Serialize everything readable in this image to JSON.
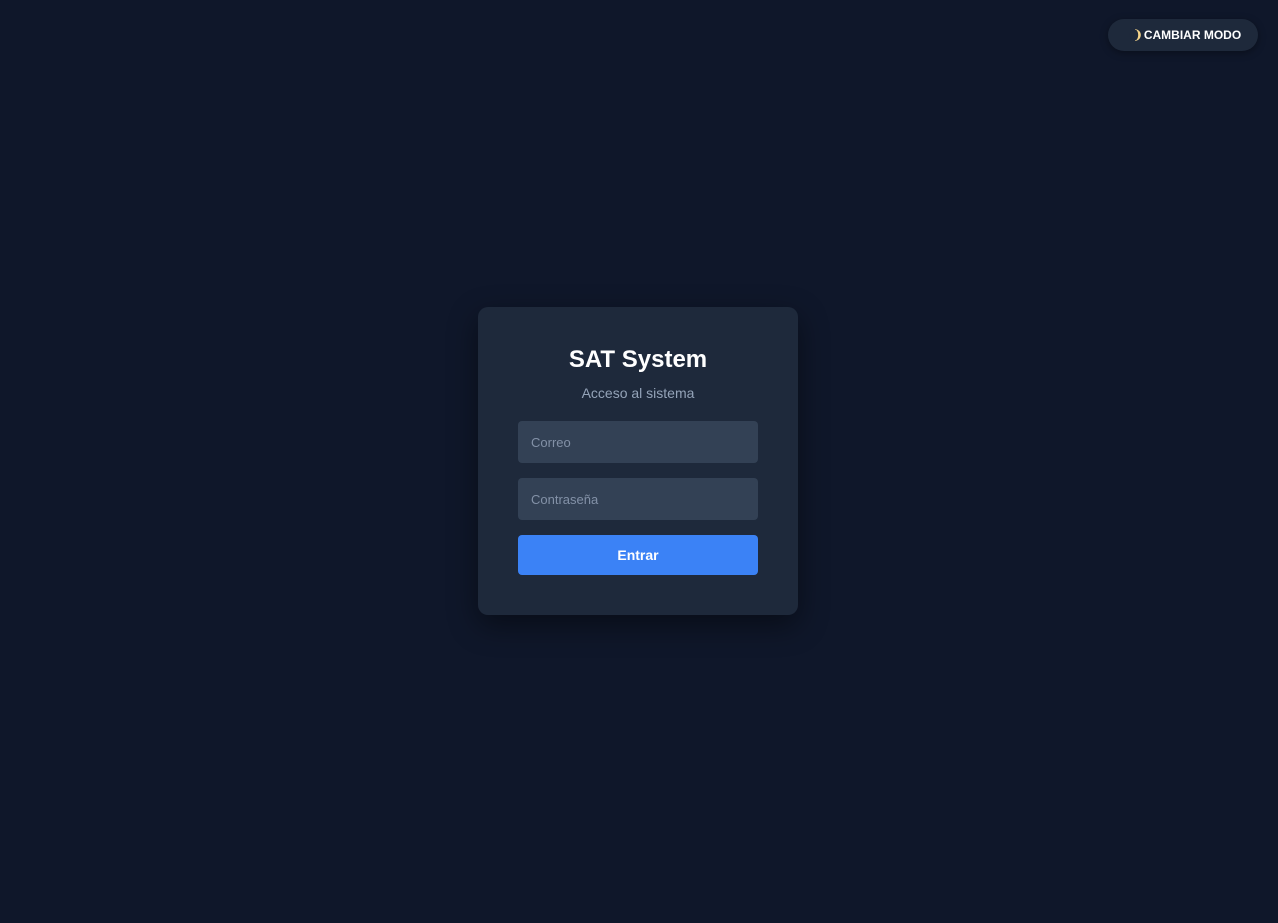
{
  "header": {
    "mode_toggle": {
      "icon": "half-moon-icon",
      "label": "CAMBIAR MODO"
    }
  },
  "login": {
    "title": "SAT System",
    "subtitle": "Acceso al sistema",
    "email": {
      "placeholder": "Correo",
      "value": ""
    },
    "password": {
      "placeholder": "Contraseña",
      "value": ""
    },
    "submit_label": "Entrar"
  },
  "colors": {
    "background": "#0f172a",
    "card": "#1e293b",
    "input": "#334155",
    "accent": "#3b82f6",
    "muted_text": "#94a3b8"
  }
}
